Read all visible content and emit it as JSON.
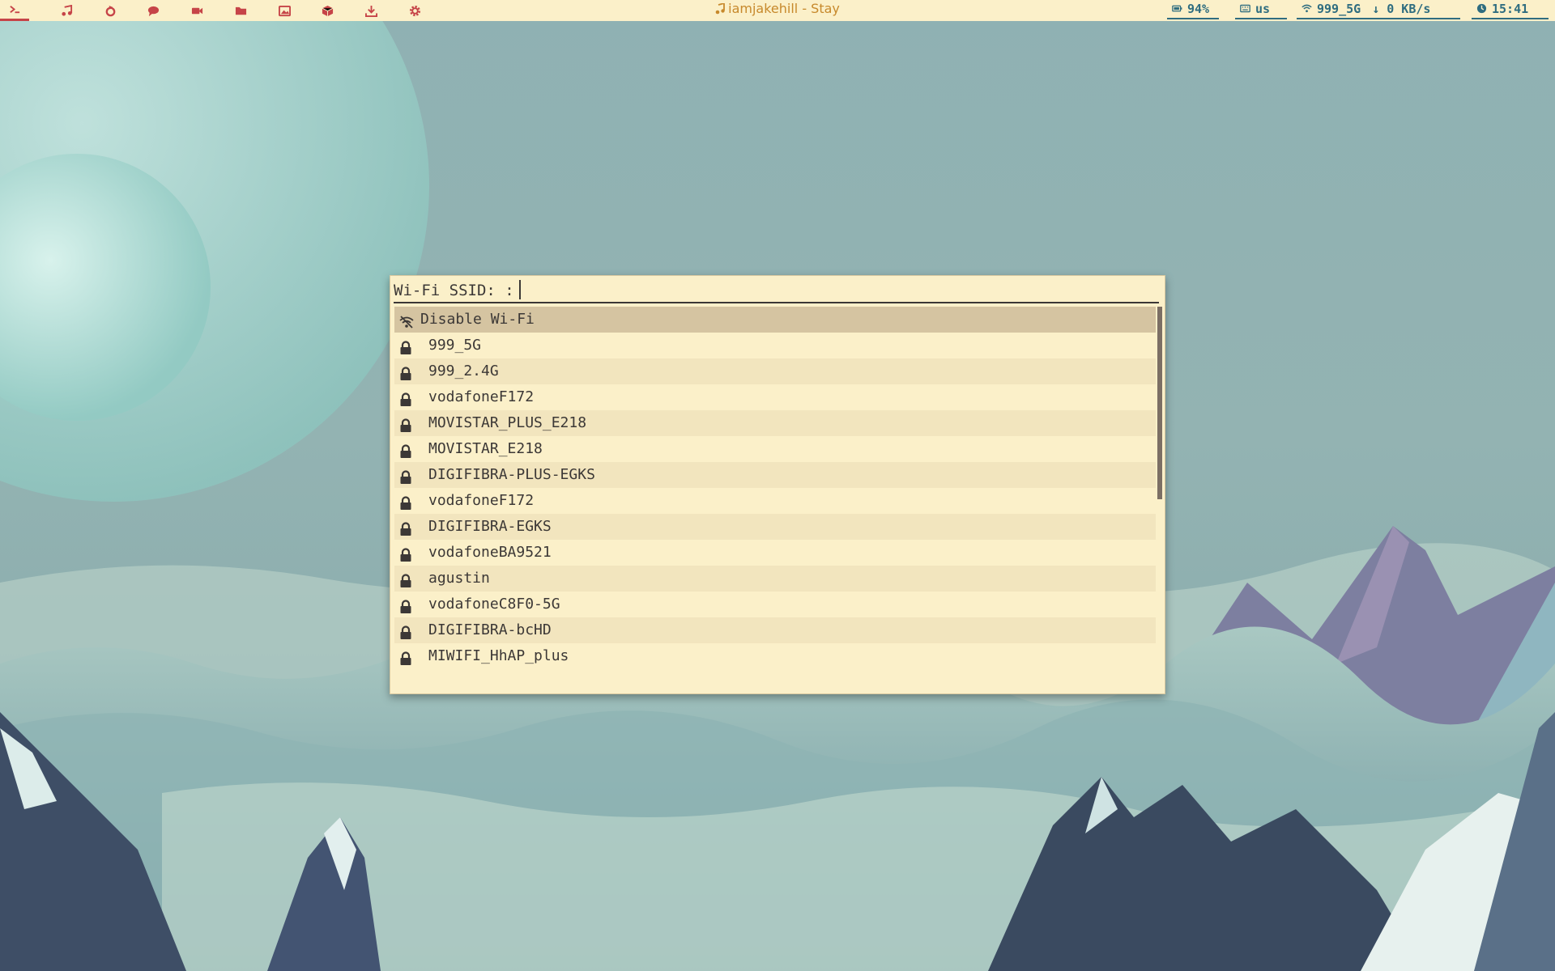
{
  "topbar": {
    "launchers": [
      {
        "icon": "terminal-icon",
        "active": true
      },
      {
        "icon": "music-icon"
      },
      {
        "icon": "refresh-icon"
      },
      {
        "icon": "chat-icon"
      },
      {
        "icon": "video-icon"
      },
      {
        "icon": "folder-icon"
      },
      {
        "icon": "image-icon"
      },
      {
        "icon": "package-icon"
      },
      {
        "icon": "download-icon"
      },
      {
        "icon": "gear-icon"
      }
    ],
    "window_title": "iamjakehill - Stay",
    "modules": {
      "battery": "94%",
      "keyboard": "us",
      "wifi": "999_5G",
      "net_speed": "↓ 0 KB/s",
      "clock": "15:41"
    },
    "colors": {
      "bar_bg": "#fbf0c9",
      "accent": "#c64448",
      "module": "#2f6d80",
      "title": "#c7892c"
    }
  },
  "menu": {
    "prompt": "Wi-Fi SSID: :",
    "input_value": "",
    "items": [
      {
        "label": "Disable Wi-Fi",
        "icon": "wifi-off-icon",
        "selected": true
      },
      {
        "label": "999_5G",
        "icon": "lock-icon"
      },
      {
        "label": "999_2.4G",
        "icon": "lock-icon"
      },
      {
        "label": "vodafoneF172",
        "icon": "lock-icon"
      },
      {
        "label": "MOVISTAR_PLUS_E218",
        "icon": "lock-icon"
      },
      {
        "label": "MOVISTAR_E218",
        "icon": "lock-icon"
      },
      {
        "label": "DIGIFIBRA-PLUS-EGKS",
        "icon": "lock-icon"
      },
      {
        "label": "vodafoneF172",
        "icon": "lock-icon"
      },
      {
        "label": "DIGIFIBRA-EGKS",
        "icon": "lock-icon"
      },
      {
        "label": "vodafoneBA9521",
        "icon": "lock-icon"
      },
      {
        "label": "agustin",
        "icon": "lock-icon"
      },
      {
        "label": "vodafoneC8F0-5G",
        "icon": "lock-icon"
      },
      {
        "label": "DIGIFIBRA-bcHD",
        "icon": "lock-icon"
      },
      {
        "label": "MIWIFI_HhAP_plus",
        "icon": "lock-icon"
      }
    ],
    "colors": {
      "bg": "#fbf0c9",
      "row_alt": "#f2e5be",
      "selected": "#d5c4a1",
      "text": "#3c3836"
    }
  }
}
